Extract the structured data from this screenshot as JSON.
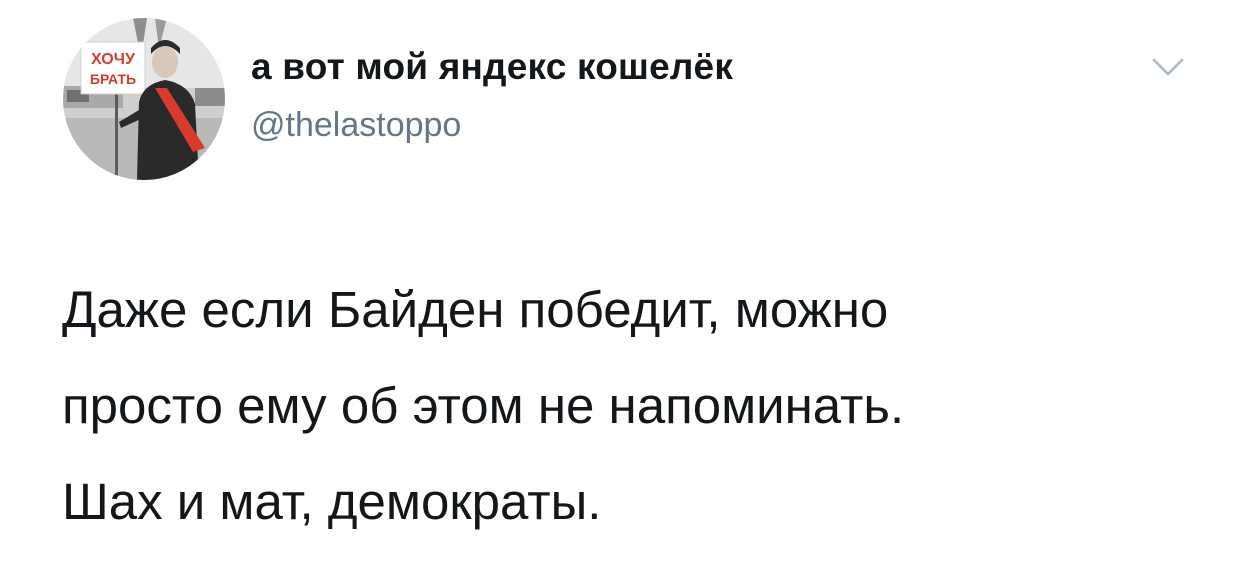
{
  "author": {
    "display_name": "а вот мой яндекс кошелёк",
    "handle": "@thelastoppo",
    "avatar_sign_text": [
      "ХОЧУ",
      "БРАТЬ"
    ]
  },
  "menu": {
    "icon": "chevron-down-icon"
  },
  "tweet": {
    "lines": [
      "Даже если Байден победит, можно",
      "просто ему об этом не напоминать.",
      "Шах и мат, демократы."
    ]
  },
  "colors": {
    "text": "#14171a",
    "secondary": "#657786",
    "chevron": "#aab8c2",
    "sign": "#d93a2b"
  }
}
